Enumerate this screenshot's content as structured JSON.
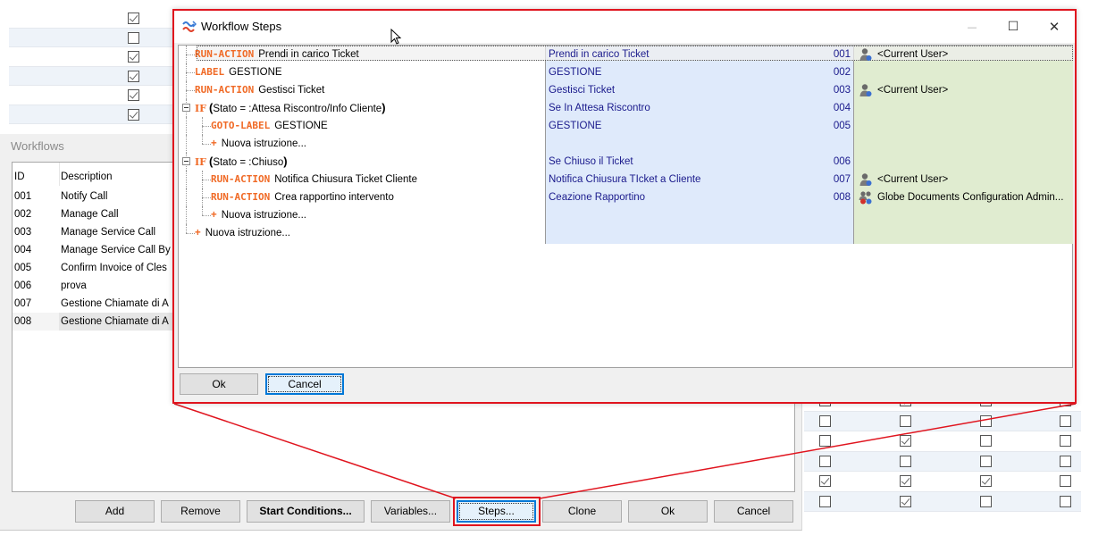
{
  "background_grid_top": {
    "rows": [
      {
        "checked": true
      },
      {
        "checked": false
      },
      {
        "checked": true
      },
      {
        "checked": true
      },
      {
        "checked": true
      },
      {
        "checked": true
      }
    ]
  },
  "background_grid_bottom": {
    "rows": [
      {
        "checks": [
          false,
          true,
          false,
          false
        ]
      },
      {
        "checks": [
          false,
          false,
          false,
          false
        ]
      },
      {
        "checks": [
          false,
          true,
          false,
          false
        ]
      },
      {
        "checks": [
          false,
          false,
          false,
          false
        ]
      },
      {
        "checks": [
          true,
          true,
          true,
          false
        ]
      },
      {
        "checks": [
          false,
          true,
          false,
          false
        ]
      }
    ]
  },
  "workflows": {
    "title": "Workflows",
    "columns": {
      "id": "ID",
      "description": "Description"
    },
    "rows": [
      {
        "id": "001",
        "description": "Notify Call"
      },
      {
        "id": "002",
        "description": "Manage Call"
      },
      {
        "id": "003",
        "description": "Manage Service Call"
      },
      {
        "id": "004",
        "description": "Manage Service Call By"
      },
      {
        "id": "005",
        "description": "Confirm Invoice of Cles"
      },
      {
        "id": "006",
        "description": "prova"
      },
      {
        "id": "007",
        "description": "Gestione Chiamate di A"
      },
      {
        "id": "008",
        "description": "Gestione Chiamate di A"
      }
    ],
    "selected_id": "008",
    "buttons": {
      "add": "Add",
      "remove": "Remove",
      "start_conditions": "Start Conditions...",
      "variables": "Variables...",
      "steps": "Steps...",
      "clone": "Clone",
      "ok": "Ok",
      "cancel": "Cancel"
    }
  },
  "dialog": {
    "title": "Workflow Steps",
    "controls": {
      "minimize": "—",
      "maximize": "☐",
      "close": "✕"
    },
    "steps": [
      {
        "keyword": "RUN-ACTION",
        "text": "Prendi in carico Ticket",
        "description": "Prendi in carico Ticket",
        "number": "001",
        "assignee": "<Current User>",
        "assignee_type": "user"
      },
      {
        "keyword": "LABEL",
        "text": "GESTIONE",
        "description": "GESTIONE",
        "number": "002",
        "assignee": "",
        "assignee_type": ""
      },
      {
        "keyword": "RUN-ACTION",
        "text": "Gestisci Ticket",
        "description": "Gestisci Ticket",
        "number": "003",
        "assignee": "<Current User>",
        "assignee_type": "user"
      },
      {
        "keyword": "IF",
        "text": "Stato =  :Attesa Riscontro/Info Cliente",
        "description": "Se In Attesa Riscontro",
        "number": "004",
        "assignee": "",
        "assignee_type": ""
      },
      {
        "keyword": "GOTO-LABEL",
        "text": "GESTIONE",
        "description": "GESTIONE",
        "number": "005",
        "assignee": "",
        "assignee_type": ""
      },
      {
        "keyword": "+",
        "text": "Nuova istruzione...",
        "description": "",
        "number": "",
        "assignee": "",
        "assignee_type": ""
      },
      {
        "keyword": "IF",
        "text": "Stato =  :Chiuso",
        "description": "Se Chiuso il Ticket",
        "number": "006",
        "assignee": "",
        "assignee_type": ""
      },
      {
        "keyword": "RUN-ACTION",
        "text": "Notifica Chiusura Ticket Cliente",
        "description": "Notifica Chiusura TIcket a Cliente",
        "number": "007",
        "assignee": "<Current User>",
        "assignee_type": "user"
      },
      {
        "keyword": "RUN-ACTION",
        "text": "Crea rapportino intervento",
        "description": "Ceazione Rapportino",
        "number": "008",
        "assignee": "Globe Documents Configuration Admin...",
        "assignee_type": "group"
      },
      {
        "keyword": "+",
        "text": "Nuova istruzione...",
        "description": "",
        "number": "",
        "assignee": "",
        "assignee_type": ""
      },
      {
        "keyword": "+",
        "text": "Nuova istruzione...",
        "description": "",
        "number": "",
        "assignee": "",
        "assignee_type": ""
      }
    ],
    "buttons": {
      "ok": "Ok",
      "cancel": "Cancel"
    }
  },
  "colors": {
    "keyword": "#f06a26",
    "description_text": "#1a1a8c",
    "description_bg": "#dfeafb",
    "assignee_bg": "#e0ecd0",
    "highlight": "#e0141e",
    "focus": "#0078d7"
  }
}
